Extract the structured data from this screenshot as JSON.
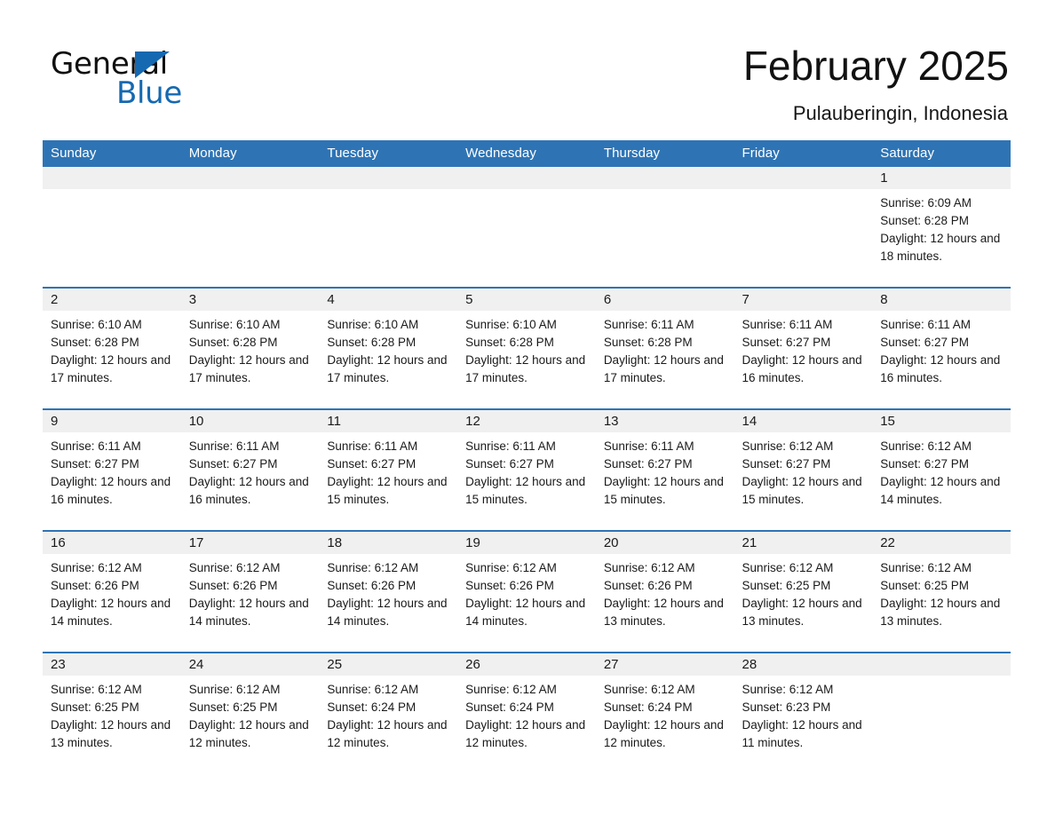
{
  "brand": {
    "name_part1": "General",
    "name_part2": "Blue",
    "accent_color": "#2e74b5",
    "logo_blue": "#1569b0"
  },
  "header": {
    "title": "February 2025",
    "location": "Pulauberingin, Indonesia"
  },
  "calendar": {
    "weekday_headers": [
      "Sunday",
      "Monday",
      "Tuesday",
      "Wednesday",
      "Thursday",
      "Friday",
      "Saturday"
    ],
    "labels": {
      "sunrise": "Sunrise:",
      "sunset": "Sunset:",
      "daylight": "Daylight:"
    },
    "weeks": [
      [
        {
          "day": "",
          "sunrise": "",
          "sunset": "",
          "daylight": "",
          "empty": true
        },
        {
          "day": "",
          "sunrise": "",
          "sunset": "",
          "daylight": "",
          "empty": true
        },
        {
          "day": "",
          "sunrise": "",
          "sunset": "",
          "daylight": "",
          "empty": true
        },
        {
          "day": "",
          "sunrise": "",
          "sunset": "",
          "daylight": "",
          "empty": true
        },
        {
          "day": "",
          "sunrise": "",
          "sunset": "",
          "daylight": "",
          "empty": true
        },
        {
          "day": "",
          "sunrise": "",
          "sunset": "",
          "daylight": "",
          "empty": true
        },
        {
          "day": "1",
          "sunrise": "Sunrise: 6:09 AM",
          "sunset": "Sunset: 6:28 PM",
          "daylight": "Daylight: 12 hours and 18 minutes."
        }
      ],
      [
        {
          "day": "2",
          "sunrise": "Sunrise: 6:10 AM",
          "sunset": "Sunset: 6:28 PM",
          "daylight": "Daylight: 12 hours and 17 minutes."
        },
        {
          "day": "3",
          "sunrise": "Sunrise: 6:10 AM",
          "sunset": "Sunset: 6:28 PM",
          "daylight": "Daylight: 12 hours and 17 minutes."
        },
        {
          "day": "4",
          "sunrise": "Sunrise: 6:10 AM",
          "sunset": "Sunset: 6:28 PM",
          "daylight": "Daylight: 12 hours and 17 minutes."
        },
        {
          "day": "5",
          "sunrise": "Sunrise: 6:10 AM",
          "sunset": "Sunset: 6:28 PM",
          "daylight": "Daylight: 12 hours and 17 minutes."
        },
        {
          "day": "6",
          "sunrise": "Sunrise: 6:11 AM",
          "sunset": "Sunset: 6:28 PM",
          "daylight": "Daylight: 12 hours and 17 minutes."
        },
        {
          "day": "7",
          "sunrise": "Sunrise: 6:11 AM",
          "sunset": "Sunset: 6:27 PM",
          "daylight": "Daylight: 12 hours and 16 minutes."
        },
        {
          "day": "8",
          "sunrise": "Sunrise: 6:11 AM",
          "sunset": "Sunset: 6:27 PM",
          "daylight": "Daylight: 12 hours and 16 minutes."
        }
      ],
      [
        {
          "day": "9",
          "sunrise": "Sunrise: 6:11 AM",
          "sunset": "Sunset: 6:27 PM",
          "daylight": "Daylight: 12 hours and 16 minutes."
        },
        {
          "day": "10",
          "sunrise": "Sunrise: 6:11 AM",
          "sunset": "Sunset: 6:27 PM",
          "daylight": "Daylight: 12 hours and 16 minutes."
        },
        {
          "day": "11",
          "sunrise": "Sunrise: 6:11 AM",
          "sunset": "Sunset: 6:27 PM",
          "daylight": "Daylight: 12 hours and 15 minutes."
        },
        {
          "day": "12",
          "sunrise": "Sunrise: 6:11 AM",
          "sunset": "Sunset: 6:27 PM",
          "daylight": "Daylight: 12 hours and 15 minutes."
        },
        {
          "day": "13",
          "sunrise": "Sunrise: 6:11 AM",
          "sunset": "Sunset: 6:27 PM",
          "daylight": "Daylight: 12 hours and 15 minutes."
        },
        {
          "day": "14",
          "sunrise": "Sunrise: 6:12 AM",
          "sunset": "Sunset: 6:27 PM",
          "daylight": "Daylight: 12 hours and 15 minutes."
        },
        {
          "day": "15",
          "sunrise": "Sunrise: 6:12 AM",
          "sunset": "Sunset: 6:27 PM",
          "daylight": "Daylight: 12 hours and 14 minutes."
        }
      ],
      [
        {
          "day": "16",
          "sunrise": "Sunrise: 6:12 AM",
          "sunset": "Sunset: 6:26 PM",
          "daylight": "Daylight: 12 hours and 14 minutes."
        },
        {
          "day": "17",
          "sunrise": "Sunrise: 6:12 AM",
          "sunset": "Sunset: 6:26 PM",
          "daylight": "Daylight: 12 hours and 14 minutes."
        },
        {
          "day": "18",
          "sunrise": "Sunrise: 6:12 AM",
          "sunset": "Sunset: 6:26 PM",
          "daylight": "Daylight: 12 hours and 14 minutes."
        },
        {
          "day": "19",
          "sunrise": "Sunrise: 6:12 AM",
          "sunset": "Sunset: 6:26 PM",
          "daylight": "Daylight: 12 hours and 14 minutes."
        },
        {
          "day": "20",
          "sunrise": "Sunrise: 6:12 AM",
          "sunset": "Sunset: 6:26 PM",
          "daylight": "Daylight: 12 hours and 13 minutes."
        },
        {
          "day": "21",
          "sunrise": "Sunrise: 6:12 AM",
          "sunset": "Sunset: 6:25 PM",
          "daylight": "Daylight: 12 hours and 13 minutes."
        },
        {
          "day": "22",
          "sunrise": "Sunrise: 6:12 AM",
          "sunset": "Sunset: 6:25 PM",
          "daylight": "Daylight: 12 hours and 13 minutes."
        }
      ],
      [
        {
          "day": "23",
          "sunrise": "Sunrise: 6:12 AM",
          "sunset": "Sunset: 6:25 PM",
          "daylight": "Daylight: 12 hours and 13 minutes."
        },
        {
          "day": "24",
          "sunrise": "Sunrise: 6:12 AM",
          "sunset": "Sunset: 6:25 PM",
          "daylight": "Daylight: 12 hours and 12 minutes."
        },
        {
          "day": "25",
          "sunrise": "Sunrise: 6:12 AM",
          "sunset": "Sunset: 6:24 PM",
          "daylight": "Daylight: 12 hours and 12 minutes."
        },
        {
          "day": "26",
          "sunrise": "Sunrise: 6:12 AM",
          "sunset": "Sunset: 6:24 PM",
          "daylight": "Daylight: 12 hours and 12 minutes."
        },
        {
          "day": "27",
          "sunrise": "Sunrise: 6:12 AM",
          "sunset": "Sunset: 6:24 PM",
          "daylight": "Daylight: 12 hours and 12 minutes."
        },
        {
          "day": "28",
          "sunrise": "Sunrise: 6:12 AM",
          "sunset": "Sunset: 6:23 PM",
          "daylight": "Daylight: 12 hours and 11 minutes."
        },
        {
          "day": "",
          "sunrise": "",
          "sunset": "",
          "daylight": "",
          "empty": true
        }
      ]
    ]
  }
}
